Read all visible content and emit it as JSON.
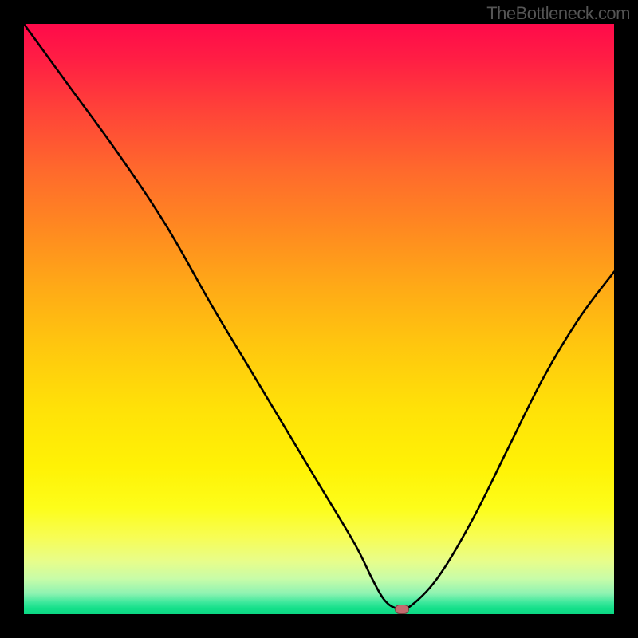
{
  "watermark": "TheBottleneck.com",
  "chart_data": {
    "type": "line",
    "title": "",
    "xlabel": "",
    "ylabel": "",
    "xlim": [
      0,
      100
    ],
    "ylim": [
      0,
      100
    ],
    "series": [
      {
        "name": "bottleneck-curve",
        "x": [
          0,
          8,
          16,
          24,
          32,
          38,
          44,
          50,
          56,
          59,
          61,
          63,
          65,
          70,
          76,
          82,
          88,
          94,
          100
        ],
        "values": [
          100,
          89,
          78,
          66,
          52,
          42,
          32,
          22,
          12,
          6,
          2.5,
          1,
          1,
          6,
          16,
          28,
          40,
          50,
          58
        ]
      }
    ],
    "marker": {
      "x": 64,
      "y": 0.8
    },
    "gradient_bands": [
      {
        "value": 100,
        "color": "#ff0a4a"
      },
      {
        "value": 50,
        "color": "#ffc80e"
      },
      {
        "value": 10,
        "color": "#fdfd1a"
      },
      {
        "value": 0,
        "color": "#0cd884"
      }
    ]
  }
}
